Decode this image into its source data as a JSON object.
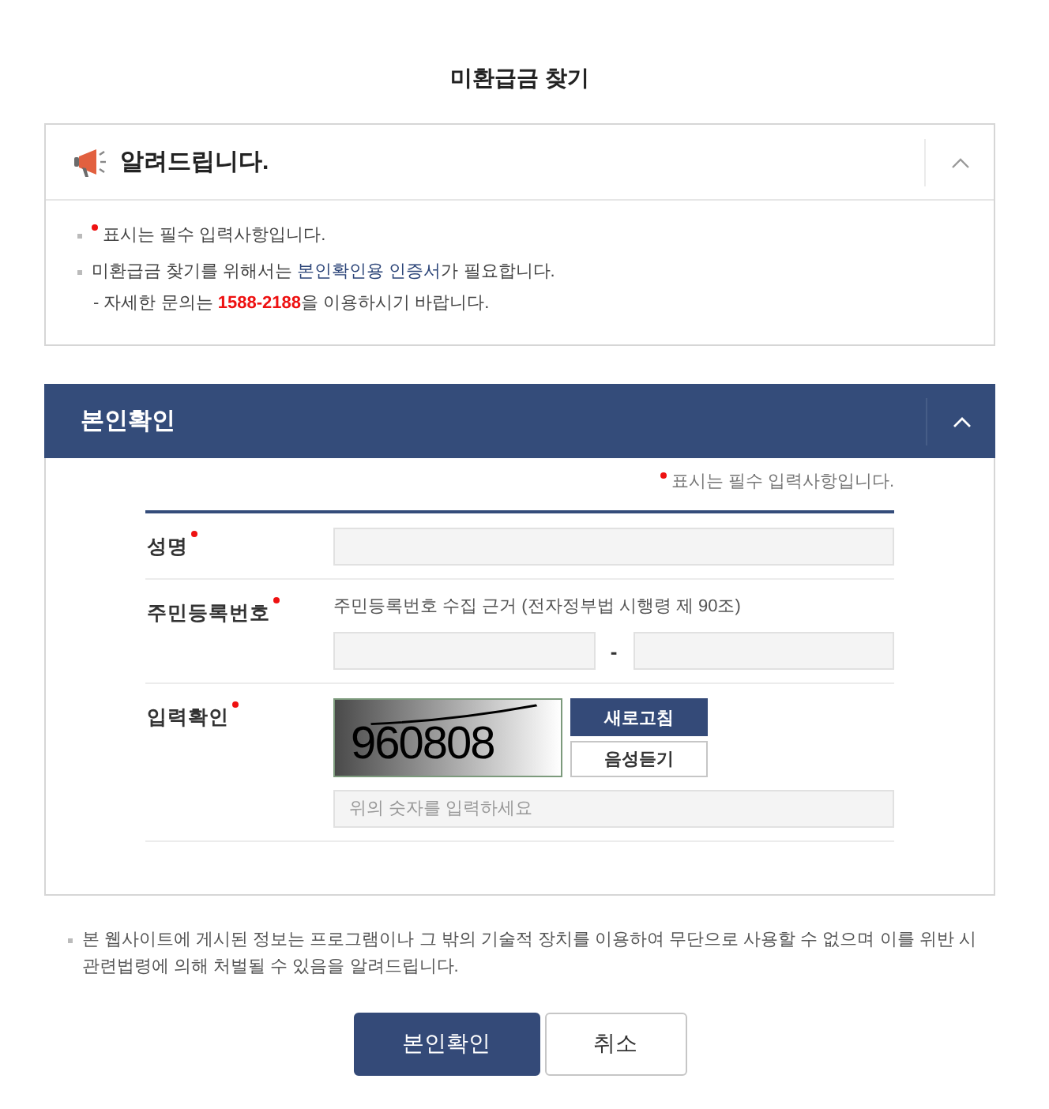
{
  "page_title": "미환급금 찾기",
  "notice_panel": {
    "title": "알려드립니다.",
    "expanded": true,
    "items": [
      {
        "kind": "bullet",
        "required": true,
        "parts": [
          {
            "kind": "plain",
            "text": "표시는 필수 입력사항입니다."
          }
        ]
      },
      {
        "kind": "bullet",
        "required": false,
        "parts": [
          {
            "kind": "plain",
            "text": "미환급금 찾기를 위해서는 "
          },
          {
            "kind": "accent",
            "text": "본인확인용 인증서"
          },
          {
            "kind": "plain",
            "text": "가 필요합니다."
          }
        ]
      },
      {
        "kind": "sub",
        "required": false,
        "parts": [
          {
            "kind": "plain",
            "text": "- 자세한 문의는 "
          },
          {
            "kind": "phone",
            "text": "1588-2188"
          },
          {
            "kind": "plain",
            "text": "을 이용하시기 바랍니다."
          }
        ]
      }
    ]
  },
  "identity_panel": {
    "title": "본인확인",
    "expanded": true,
    "required_note": "표시는 필수 입력사항입니다.",
    "rows": [
      {
        "kind": "name",
        "label": "성명",
        "required": true
      },
      {
        "kind": "resident_number",
        "label": "주민등록번호",
        "required": true,
        "note": "주민등록번호 수집 근거 (전자정부법 시행령 제 90조)",
        "separator": "-"
      },
      {
        "kind": "captcha",
        "label": "입력확인",
        "required": true,
        "captcha_code": "960808",
        "buttons": [
          {
            "kind": "primary",
            "label": "새로고침"
          },
          {
            "kind": "secondary",
            "label": "음성듣기"
          }
        ],
        "placeholder": "위의 숫자를 입력하세요"
      }
    ]
  },
  "footer_notice": "본 웹사이트에 게시된 정보는 프로그램이나 그 밖의 기술적 장치를 이용하여 무단으로 사용할 수 없으며 이를 위반 시 관련법령에 의해 처벌될 수 있음을 알려드립니다.",
  "actions": [
    {
      "kind": "primary",
      "label": "본인확인"
    },
    {
      "kind": "secondary",
      "label": "취소"
    }
  ]
}
